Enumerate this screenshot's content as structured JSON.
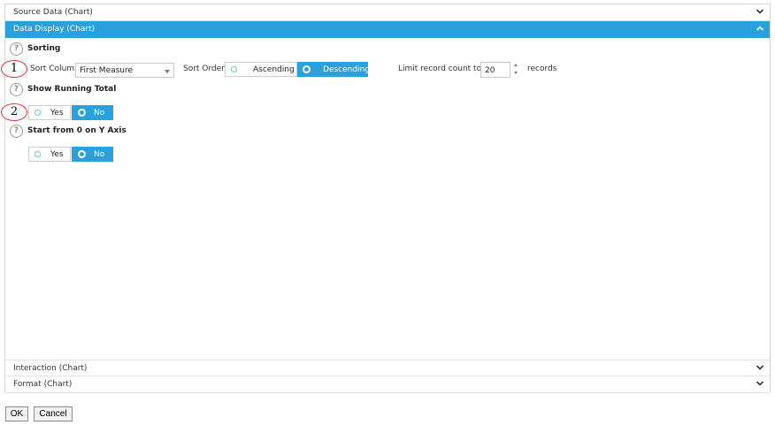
{
  "accordion": {
    "source_data": "Source Data (Chart)",
    "data_display": "Data Display (Chart)",
    "interaction": "Interaction (Chart)",
    "format": "Format (Chart)"
  },
  "sorting": {
    "title": "Sorting",
    "callout": "1",
    "sort_column_label": "Sort Column",
    "sort_column_value": "First Measure",
    "sort_order_label": "Sort Order",
    "ascending": "Ascending",
    "descending": "Descending",
    "selected_order": "Descending",
    "limit_label": "Limit record count to",
    "limit_value": "20",
    "records_label": "records"
  },
  "running_total": {
    "title": "Show Running Total",
    "callout": "2",
    "yes": "Yes",
    "no": "No",
    "selected": "No"
  },
  "y_axis_zero": {
    "title": "Start from 0 on Y Axis",
    "yes": "Yes",
    "no": "No",
    "selected": "No"
  },
  "help_glyph": "?",
  "footer": {
    "ok": "OK",
    "cancel": "Cancel"
  },
  "colors": {
    "accent": "#29a1dc",
    "callout_border": "#dd3333"
  },
  "icons": [
    "chevron-down-icon",
    "chevron-up-icon",
    "help-icon",
    "radio-dot-icon",
    "spinner-icon",
    "dropdown-arrow-icon"
  ]
}
